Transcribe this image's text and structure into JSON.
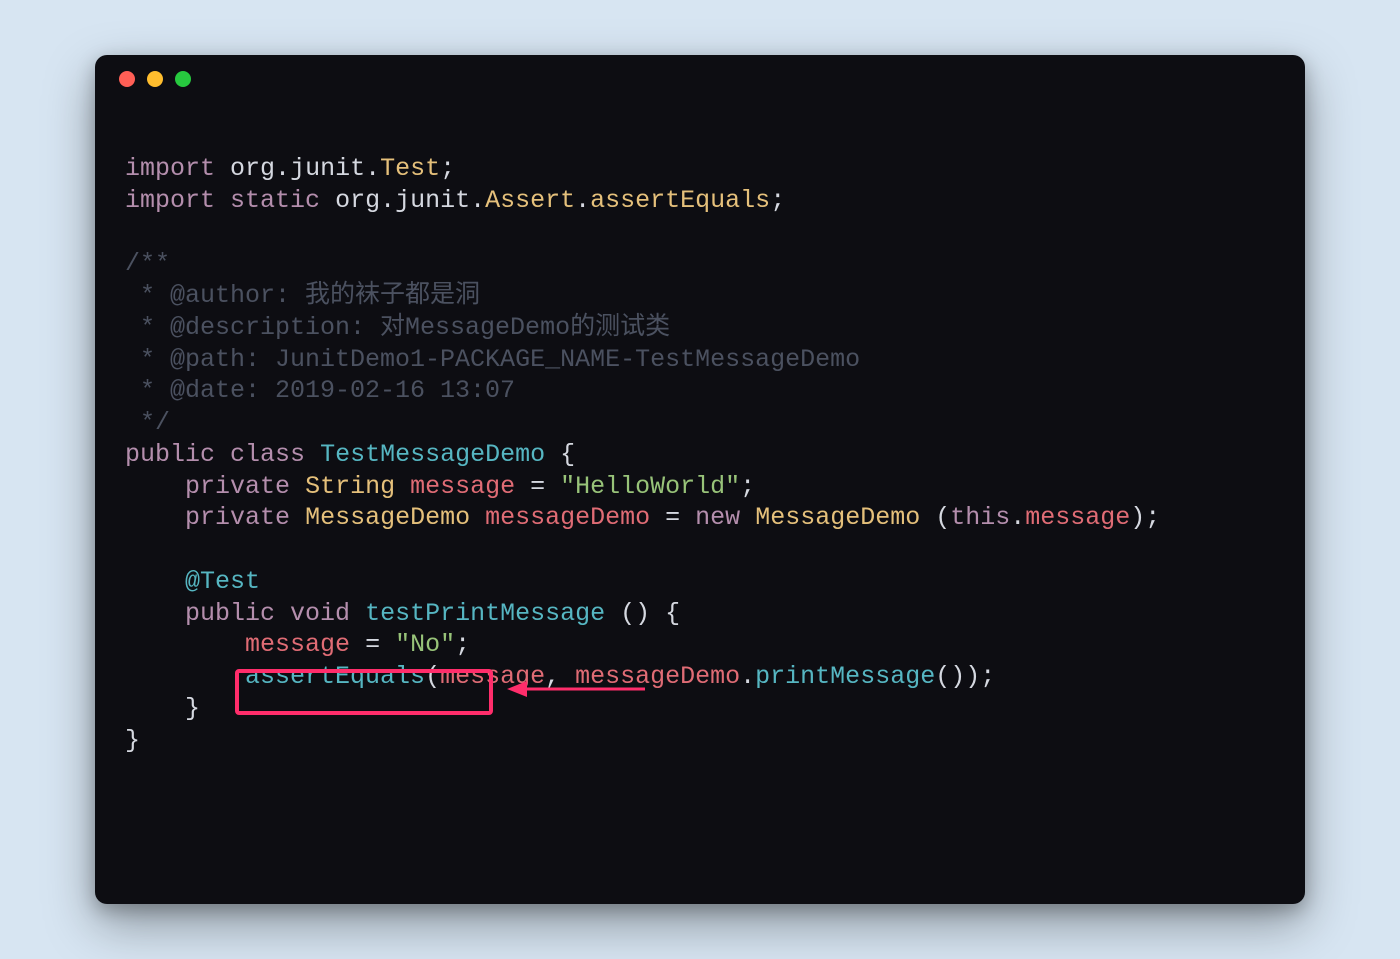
{
  "code": {
    "l1": {
      "import": "import",
      "pkg": "org",
      "d1": ".",
      "junit": "junit",
      "d2": ".",
      "Test": "Test",
      "semi": ";"
    },
    "l2": {
      "import": "import",
      "static": "static",
      "pkg": "org",
      "d1": ".",
      "junit": "junit",
      "d2": ".",
      "Assert": "Assert",
      "d3": ".",
      "ae": "assertEquals",
      "semi": ";"
    },
    "c1": "/**",
    "c2": " * @author: 我的袜子都是洞",
    "c3": " * @description: 对MessageDemo的测试类",
    "c4": " * @path: JunitDemo1-PACKAGE_NAME-TestMessageDemo",
    "c5": " * @date: 2019-02-16 13:07",
    "c6": " */",
    "l3": {
      "public": "public",
      "class": "class",
      "name": "TestMessageDemo",
      "open": " {"
    },
    "l4": {
      "indent": "    ",
      "private": "private",
      "String": "String",
      "msg": "message",
      "eq": " = ",
      "val": "\"HelloWorld\"",
      "semi": ";"
    },
    "l5": {
      "indent": "    ",
      "private": "private",
      "Type": "MessageDemo",
      "var": "messageDemo",
      "eq": " = ",
      "new": "new",
      "Ctor": "MessageDemo",
      "sp": " (",
      "this": "this",
      "dot": ".",
      "msg": "message",
      "close": ");"
    },
    "l6": {
      "indent": "    ",
      "anno": "@Test"
    },
    "l7": {
      "indent": "    ",
      "public": "public",
      "void": "void",
      "name": "testPrintMessage",
      "rest": " () {"
    },
    "l8": {
      "indent": "        ",
      "msg": "message",
      "eq": " = ",
      "val": "\"No\"",
      "semi": ";"
    },
    "l9": {
      "indent": "        ",
      "ae": "assertEquals",
      "op": "(",
      "msg": "message",
      "comma": ", ",
      "md": "messageDemo",
      "dot": ".",
      "pm": "printMessage",
      "rest": "());"
    },
    "l10": "    }",
    "l11": "}"
  }
}
